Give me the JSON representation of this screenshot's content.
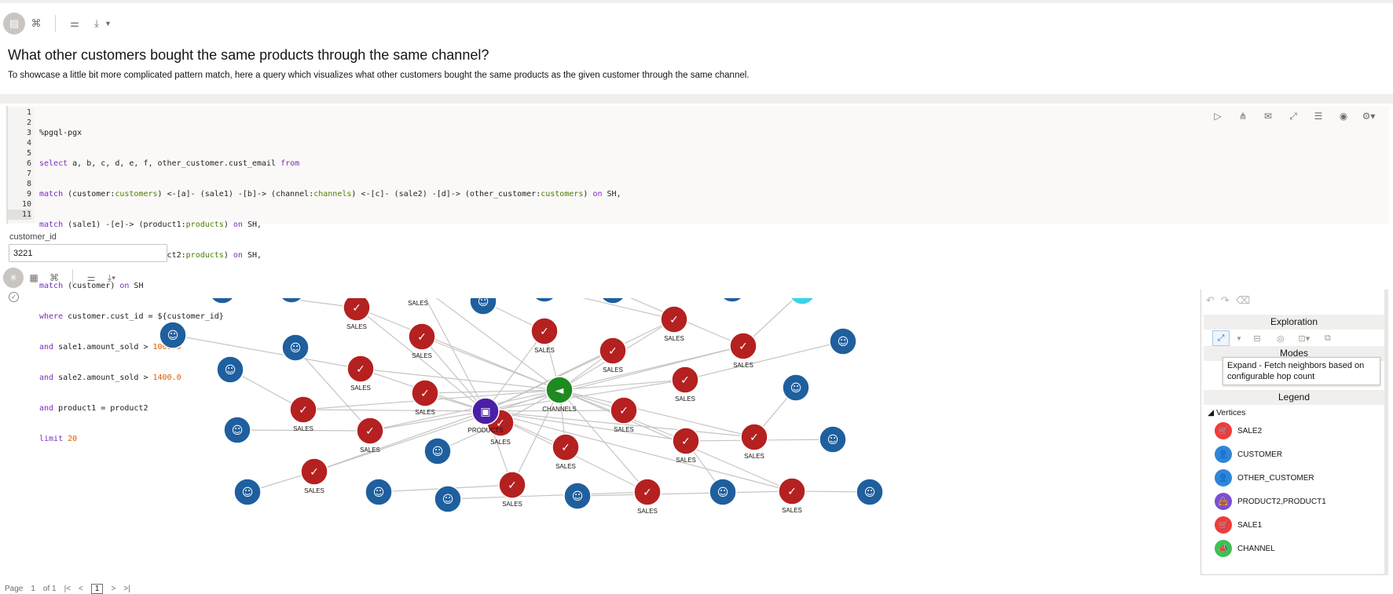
{
  "notebook": {
    "toolbar": {
      "icons": [
        "notebook-icon",
        "code-icon",
        "settings-sliders-icon",
        "download-icon"
      ]
    },
    "title": "What other customers bought the same products through the same channel?",
    "description": "To showcase a little bit more complicated pattern match, here a query which visualizes what other customers bought the same products as the given customer through the same channel."
  },
  "editor": {
    "line_numbers": [
      "1",
      "2",
      "3",
      "4",
      "5",
      "6",
      "7",
      "8",
      "9",
      "10",
      "11"
    ],
    "lines": [
      "%pgql-pgx",
      "select a, b, c, d, e, f, other_customer.cust_email from",
      "match (customer:customers) <-[a]- (sale1) -[b]-> (channel:channels) <-[c]- (sale2) -[d]-> (other_customer:customers) on SH,",
      "match (sale1) -[e]-> (product1:products) on SH,",
      "match (sale2) -[f]-> (product2:products) on SH,",
      "match (customer) on SH",
      "where customer.cust_id = ${customer_id}",
      "and sale1.amount_sold > 1000.0",
      "and sale2.amount_sold > 1400.0",
      "and product1 = product2",
      "limit 20"
    ]
  },
  "paragraph_tools": [
    "run-icon",
    "graph-icon",
    "comments-icon",
    "fullscreen-icon",
    "list-icon",
    "visibility-icon",
    "settings-icon"
  ],
  "param": {
    "label": "customer_id",
    "value": "3221"
  },
  "graph": {
    "labels": {
      "sales": "SALES",
      "products": "PRODUCTS",
      "channels": "CHANNELS"
    },
    "colors": {
      "customer": "#1f5f9e",
      "sale": "#b52020",
      "product": "#4b1fa8",
      "channel": "#1f8a1f",
      "highlight": "#3ad3ea",
      "edge": "#c7c5c3"
    }
  },
  "panel": {
    "exploration_title": "Exploration",
    "modes_title": "Modes",
    "tooltip": "Expand - Fetch neighbors based on configurable hop count",
    "legend_title": "Legend",
    "vertices_title": "Vertices",
    "legend": [
      {
        "label": "SALE2",
        "color": "#ef3b3b",
        "icon": "cart-icon"
      },
      {
        "label": "CUSTOMER",
        "color": "#2f86d8",
        "icon": "user-icon"
      },
      {
        "label": "OTHER_CUSTOMER",
        "color": "#2f86d8",
        "icon": "user-icon"
      },
      {
        "label": "PRODUCT2,PRODUCT1",
        "color": "#7a4fd6",
        "icon": "bag-icon"
      },
      {
        "label": "SALE1",
        "color": "#ef3b3b",
        "icon": "cart-icon"
      },
      {
        "label": "CHANNEL",
        "color": "#3fbf56",
        "icon": "megaphone-icon"
      }
    ]
  },
  "pager": {
    "page_label": "Page",
    "page": "1",
    "of_label": "of 1",
    "current": "1"
  }
}
